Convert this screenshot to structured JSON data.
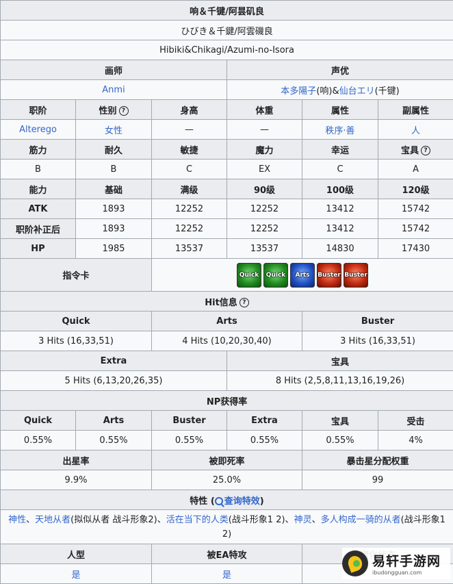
{
  "title_rows": [
    "响＆千键/阿昙矶良",
    "ひびき＆千鍵/阿雲磯良",
    "Hibiki&Chikagi/Azumi-no-Isora"
  ],
  "credits": {
    "illustrator_h": "画师",
    "voice_h": "声优",
    "illustrator": "Anmi",
    "va1": "本多陽子",
    "va1_note": "(响)&",
    "va2": "仙台エリ",
    "va2_note": "(千键)"
  },
  "basic": {
    "headers": [
      "职阶",
      "性别",
      "身高",
      "体重",
      "属性",
      "副属性"
    ],
    "values": [
      "Alterego",
      "女性",
      "—",
      "—",
      "秩序·善",
      "人"
    ]
  },
  "params": {
    "headers": [
      "筋力",
      "耐久",
      "敏捷",
      "魔力",
      "幸运",
      "宝具"
    ],
    "values": [
      "B",
      "B",
      "C",
      "EX",
      "C",
      "A"
    ]
  },
  "stats": {
    "headers": [
      "能力",
      "基础",
      "满级",
      "90级",
      "100级",
      "120级"
    ],
    "rows": [
      {
        "label": "ATK",
        "values": [
          "1893",
          "12252",
          "12252",
          "13412",
          "15742"
        ]
      },
      {
        "label": "职阶补正后",
        "values": [
          "1893",
          "12252",
          "12252",
          "13412",
          "15742"
        ]
      },
      {
        "label": "HP",
        "values": [
          "1985",
          "13537",
          "13537",
          "14830",
          "17430"
        ]
      }
    ]
  },
  "command": {
    "label": "指令卡",
    "cards": [
      {
        "type": "quick",
        "text": "Quick"
      },
      {
        "type": "quick",
        "text": "Quick"
      },
      {
        "type": "arts",
        "text": "Arts"
      },
      {
        "type": "buster",
        "text": "Buster"
      },
      {
        "type": "buster",
        "text": "Buster"
      }
    ]
  },
  "hits": {
    "title": "Hit信息",
    "row1_headers": [
      "Quick",
      "Arts",
      "Buster"
    ],
    "row1_values": [
      "3 Hits (16,33,51)",
      "4 Hits (10,20,30,40)",
      "3 Hits (16,33,51)"
    ],
    "row2_headers": [
      "Extra",
      "宝具"
    ],
    "row2_values": [
      "5 Hits (6,13,20,26,35)",
      "8 Hits (2,5,8,11,13,16,19,26)"
    ]
  },
  "np": {
    "title": "NP获得率",
    "headers": [
      "Quick",
      "Arts",
      "Buster",
      "Extra",
      "宝具",
      "受击"
    ],
    "values": [
      "0.55%",
      "0.55%",
      "0.55%",
      "0.55%",
      "0.55%",
      "4%"
    ]
  },
  "star": {
    "headers": [
      "出星率",
      "被即死率",
      "暴击星分配权重"
    ],
    "values": [
      "9.9%",
      "25.0%",
      "99"
    ]
  },
  "traits": {
    "title": "特性",
    "link": "查询特效",
    "items": [
      {
        "link": "神性",
        "sep": "、"
      },
      {
        "link": "天地从者",
        "note": "(拟似从者 战斗形象2)、"
      },
      {
        "link": "活在当下的人类",
        "note": "(战斗形象1 2)、"
      },
      {
        "link": "神灵",
        "sep": "、"
      },
      {
        "link": "多人构成一骑的从者",
        "note": "(战斗形象1 2)"
      }
    ]
  },
  "bottom": {
    "headers": [
      "人型",
      "被EA特攻",
      "猪化状态"
    ],
    "values": [
      "是",
      "是",
      ""
    ]
  },
  "watermark": {
    "title": "易轩手游网",
    "url": "ibudongguan.com"
  }
}
